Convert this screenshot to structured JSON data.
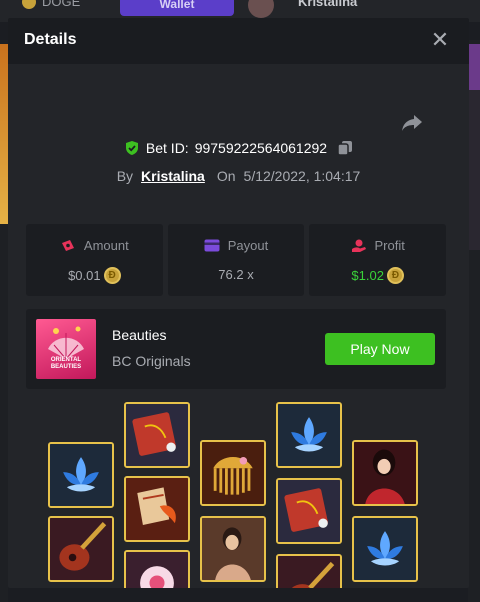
{
  "background": {
    "currency": "DOGE",
    "wallet_label": "Wallet",
    "username": "Kristalina"
  },
  "modal": {
    "title": "Details",
    "bet_id_label": "Bet ID:",
    "bet_id": "99759222564061292",
    "by_label": "By",
    "user": "Kristalina",
    "on_label": "On",
    "datetime": "5/12/2022, 1:04:17"
  },
  "stats": {
    "amount_label": "Amount",
    "amount_value": "$0.01",
    "payout_label": "Payout",
    "payout_value": "76.2 x",
    "profit_label": "Profit",
    "profit_value": "$1.02"
  },
  "game": {
    "name": "Beauties",
    "provider": "BC Originals",
    "thumb_text": "ORIENTAL BEAUTIES",
    "play_label": "Play Now"
  },
  "colors": {
    "accent_green": "#3dc021",
    "profit_green": "#3ad23a",
    "tile_border": "#e7c24a"
  },
  "reel_symbols": [
    "blue-lotus",
    "red-fan",
    "guitar-lute",
    "pipa",
    "koi-fish",
    "white-lotus",
    "gold-comb",
    "lady",
    "blue-lotus",
    "red-fan",
    "guitar-lute",
    "lady-red",
    "blue-lotus"
  ]
}
